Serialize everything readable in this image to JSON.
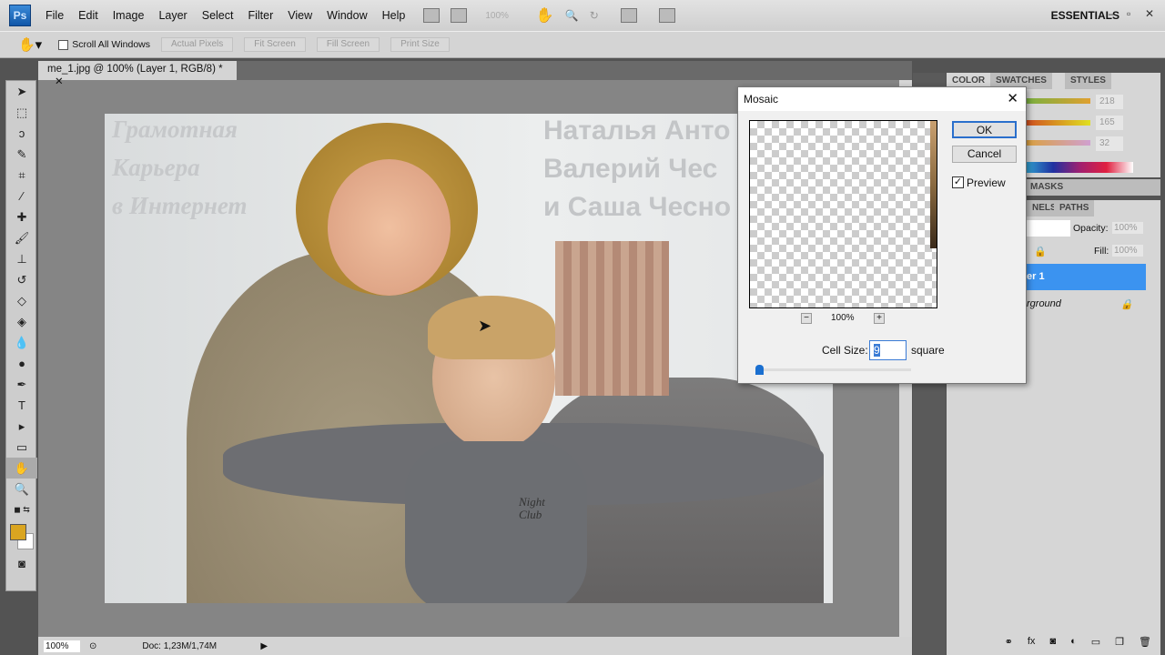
{
  "app": {
    "logo": "Ps",
    "menu": [
      "File",
      "Edit",
      "Image",
      "Layer",
      "Select",
      "Filter",
      "View",
      "Window",
      "Help"
    ],
    "zoom_display": "100%",
    "workspace": "ESSENTIALS"
  },
  "options": {
    "scroll_all": "Scroll All Windows",
    "buttons": [
      "Actual Pixels",
      "Fit Screen",
      "Fill Screen",
      "Print Size"
    ]
  },
  "document": {
    "tab": "me_1.jpg @ 100% (Layer 1, RGB/8) *",
    "overlay_left": [
      "Грамотная",
      "Карьера",
      "в Интернет"
    ],
    "overlay_right": [
      "Наталья Анто",
      "Валерий Чес",
      "и Саша Чесно"
    ],
    "shirt_text": [
      "Night",
      "Club"
    ]
  },
  "status": {
    "zoom": "100%",
    "doc": "Doc: 1,23M/1,74M"
  },
  "color_panel": {
    "tabs": [
      "COLOR",
      "SWATCHES",
      "STYLES"
    ],
    "values": [
      "218",
      "165",
      "32"
    ],
    "foreground": "#daa520"
  },
  "masks_panel": {
    "tab": "MASKS"
  },
  "layers_panel": {
    "tabs": [
      "NELS",
      "PATHS"
    ],
    "opacity_label": "Opacity:",
    "opacity": "100%",
    "fill_label": "Fill:",
    "fill": "100%",
    "layers": [
      "er 1",
      "rground"
    ],
    "selected_color": "#3b93f0"
  },
  "dialog": {
    "title": "Mosaic",
    "ok": "OK",
    "cancel": "Cancel",
    "preview_label": "Preview",
    "preview_checked": true,
    "zoom": "100%",
    "cell_size_label": "Cell Size:",
    "cell_size": "9",
    "unit": "square"
  }
}
